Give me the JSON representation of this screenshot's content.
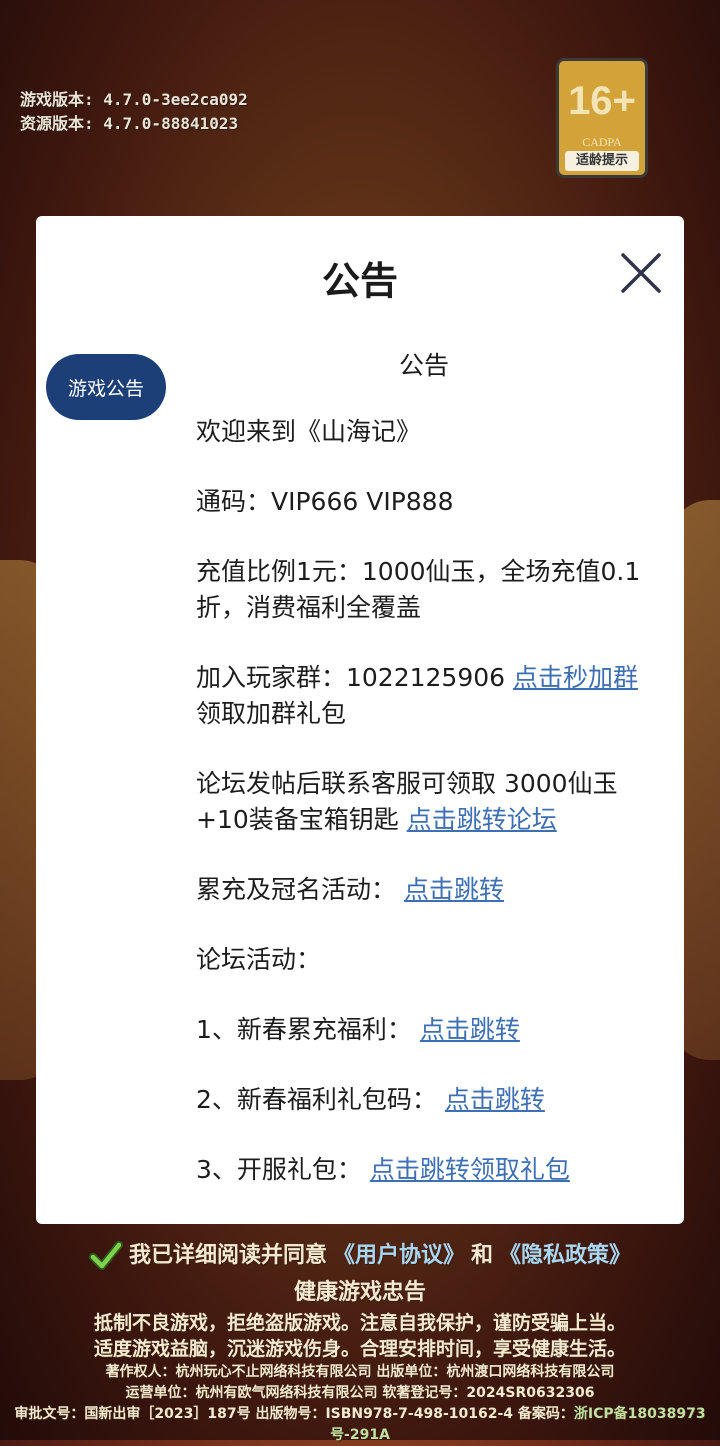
{
  "version": {
    "game": "游戏版本:  4.7.0-3ee2ca092",
    "resource": "资源版本:  4.7.0-88841023"
  },
  "age_badge": {
    "rating": "16+",
    "org": "CADPA",
    "tip": "适龄提示"
  },
  "modal": {
    "title": "公告",
    "close_icon": "close-icon",
    "tab_label": "游戏公告",
    "content": {
      "heading": "公告",
      "welcome": "欢迎来到《山海记》",
      "code": "通码：VIP666 VIP888",
      "recharge": "充值比例1元：1000仙玉，全场充值0.1折，消费福利全覆盖",
      "group_prefix": "加入玩家群：1022125906 ",
      "group_link": "点击秒加群",
      "group_suffix": " 领取加群礼包",
      "forum_prefix": "论坛发帖后联系客服可领取 3000仙玉+10装备宝箱钥匙 ",
      "forum_link": "点击跳转论坛",
      "event_prefix": "累充及冠名活动： ",
      "event_link": "点击跳转",
      "forum_activity": "论坛活动：",
      "item1_prefix": "1、新春累充福利： ",
      "item1_link": "点击跳转",
      "item2_prefix": "2、新春福利礼包码： ",
      "item2_link": "点击跳转",
      "item3_prefix": "3、开服礼包： ",
      "item3_link": "点击跳转领取礼包"
    }
  },
  "footer": {
    "agree_prefix": "我已详细阅读并同意",
    "user_agreement": "《用户协议》",
    "and": "和",
    "privacy_policy": "《隐私政策》",
    "health_title": "健康游戏忠告",
    "health_line1": "抵制不良游戏，拒绝盗版游戏。注意自我保护，谨防受骗上当。",
    "health_line2": "适度游戏益脑，沉迷游戏伤身。合理安排时间，享受健康生活。",
    "copyright": "著作权人：杭州玩心不止网络科技有限公司  出版单位：杭州渡口网络科技有限公司",
    "operator": "运营单位：杭州有欧气网络科技有限公司  软著登记号：2024SR0632306",
    "approval": "审批文号：国新出审［2023］187号 出版物号：ISBN978-7-498-10162-4 备案码：",
    "icp": "浙ICP备18038973号-291A"
  },
  "colors": {
    "modal_bg": "#ffffff",
    "tab_bg": "#1d3f78",
    "link": "#3e6fb3",
    "badge": "#d3a33a"
  }
}
